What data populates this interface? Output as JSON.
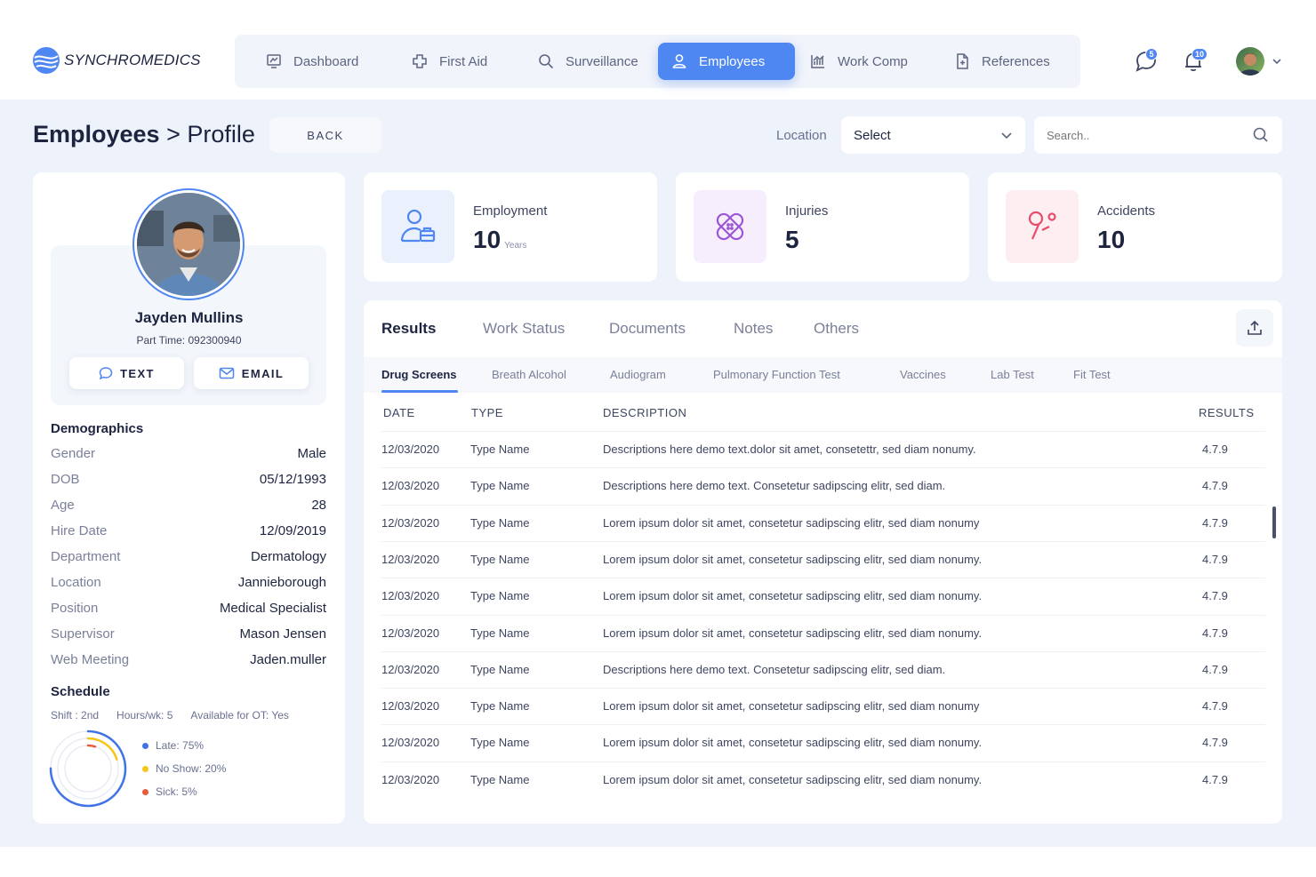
{
  "app": {
    "name": "SYNCHROMEDICS"
  },
  "nav": {
    "items": [
      {
        "label": "Dashboard",
        "icon": "dashboard-icon"
      },
      {
        "label": "First Aid",
        "icon": "first-aid-icon"
      },
      {
        "label": "Surveillance",
        "icon": "search-icon"
      },
      {
        "label": "Employees",
        "icon": "user-icon",
        "active": true
      },
      {
        "label": "Work Comp",
        "icon": "chart-icon"
      },
      {
        "label": "References",
        "icon": "document-icon"
      }
    ]
  },
  "header": {
    "messages_badge": "5",
    "notifications_badge": "10"
  },
  "page": {
    "section": "Employees",
    "separator": ">",
    "title": "Profile",
    "back_label": "BACK"
  },
  "filters": {
    "location_label": "Location",
    "location_value": "Select",
    "search_placeholder": "Search.."
  },
  "profile": {
    "name": "Jayden Mullins",
    "subtitle": "Part Time: 092300940",
    "text_label": "TEXT",
    "email_label": "EMAIL",
    "demographics_title": "Demographics",
    "demographics": [
      {
        "k": "Gender",
        "v": "Male"
      },
      {
        "k": "DOB",
        "v": "05/12/1993"
      },
      {
        "k": "Age",
        "v": "28"
      },
      {
        "k": "Hire Date",
        "v": "12/09/2019"
      },
      {
        "k": "Department",
        "v": "Dermatology"
      },
      {
        "k": "Location",
        "v": "Jannieborough"
      },
      {
        "k": "Position",
        "v": "Medical Specialist"
      },
      {
        "k": "Supervisor",
        "v": "Mason Jensen"
      },
      {
        "k": "Web Meeting",
        "v": "Jaden.muller"
      }
    ],
    "schedule_title": "Schedule",
    "schedule": {
      "shift": "Shift : 2nd",
      "hours": "Hours/wk: 5",
      "ot": "Available for OT: Yes"
    },
    "attendance": [
      {
        "label": "Late: 75%",
        "value": 0.75,
        "color": "#3f73e6"
      },
      {
        "label": "No Show: 20%",
        "value": 0.2,
        "color": "#f5c518"
      },
      {
        "label": "Sick: 5%",
        "value": 0.05,
        "color": "#e85a3a"
      }
    ]
  },
  "stats": [
    {
      "label": "Employment",
      "value": "10",
      "unit": "Years",
      "icon": "employment-icon",
      "bg": "#eaf1fd",
      "color": "#4e86f2"
    },
    {
      "label": "Injuries",
      "value": "5",
      "unit": "",
      "icon": "bandage-icon",
      "bg": "#f6eefd",
      "color": "#9b55d6"
    },
    {
      "label": "Accidents",
      "value": "10",
      "unit": "",
      "icon": "accident-icon",
      "bg": "#fdeef1",
      "color": "#e84c6a"
    }
  ],
  "results": {
    "tabs": [
      "Results",
      "Work Status",
      "Documents",
      "Notes",
      "Others"
    ],
    "subtabs": [
      "Drug Screens",
      "Breath Alcohol",
      "Audiogram",
      "Pulmonary Function Test",
      "Vaccines",
      "Lab Test",
      "Fit Test"
    ],
    "columns": [
      "DATE",
      "TYPE",
      "DESCRIPTION",
      "RESULTS"
    ],
    "rows": [
      {
        "date": "12/03/2020",
        "type": "Type Name",
        "desc": "Descriptions here demo text.dolor sit amet, consetettr, sed diam nonumy.",
        "result": "4.7.9"
      },
      {
        "date": "12/03/2020",
        "type": "Type Name",
        "desc": "Descriptions here demo text. Consetetur sadipscing elitr, sed diam.",
        "result": "4.7.9"
      },
      {
        "date": "12/03/2020",
        "type": "Type Name",
        "desc": "Lorem ipsum dolor sit amet, consetetur sadipscing elitr, sed diam nonumy",
        "result": "4.7.9"
      },
      {
        "date": "12/03/2020",
        "type": "Type Name",
        "desc": "Lorem ipsum dolor sit amet, consetetur sadipscing elitr, sed diam nonumy.",
        "result": "4.7.9"
      },
      {
        "date": "12/03/2020",
        "type": "Type Name",
        "desc": "Lorem ipsum dolor sit amet, consetetur sadipscing elitr, sed diam nonumy.",
        "result": "4.7.9"
      },
      {
        "date": "12/03/2020",
        "type": "Type Name",
        "desc": "Lorem ipsum dolor sit amet, consetetur sadipscing elitr, sed diam nonumy.",
        "result": "4.7.9"
      },
      {
        "date": "12/03/2020",
        "type": "Type Name",
        "desc": "Descriptions here demo text. Consetetur sadipscing elitr, sed diam.",
        "result": "4.7.9"
      },
      {
        "date": "12/03/2020",
        "type": "Type Name",
        "desc": "Lorem ipsum dolor sit amet, consetetur sadipscing elitr, sed diam nonumy",
        "result": "4.7.9"
      },
      {
        "date": "12/03/2020",
        "type": "Type Name",
        "desc": "Lorem ipsum dolor sit amet, consetetur sadipscing elitr, sed diam nonumy.",
        "result": "4.7.9"
      },
      {
        "date": "12/03/2020",
        "type": "Type Name",
        "desc": "Lorem ipsum dolor sit amet, consetetur sadipscing elitr, sed diam nonumy.",
        "result": "4.7.9"
      }
    ]
  },
  "colors": {
    "accent": "#4e86f2",
    "text": "#1d2440",
    "muted": "#7a8099"
  }
}
